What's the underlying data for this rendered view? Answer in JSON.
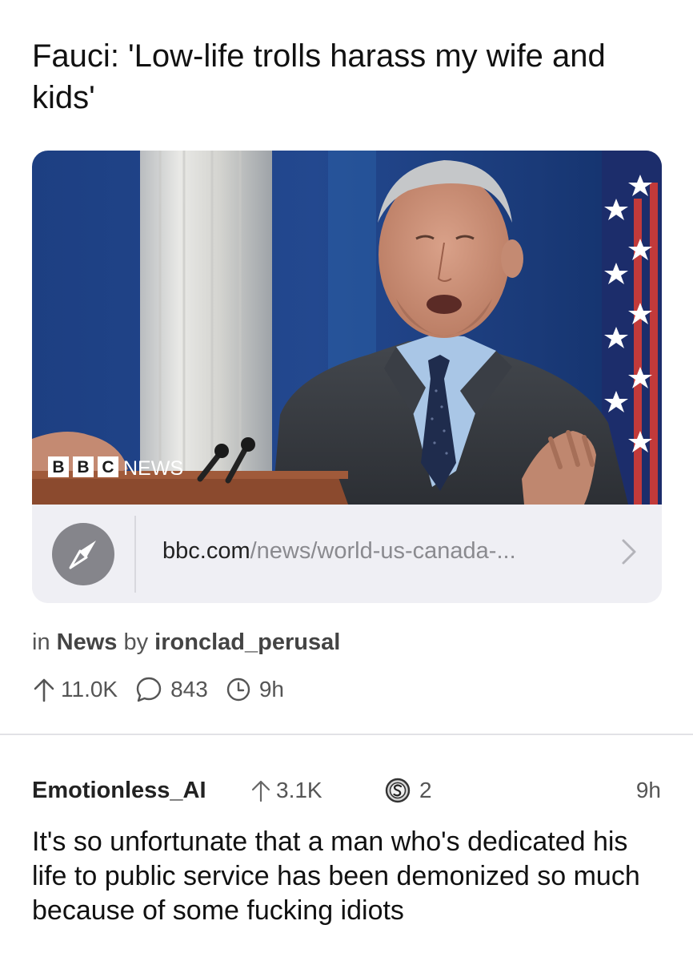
{
  "post": {
    "title": "Fauci: 'Low-life trolls harass my wife and kids'",
    "thumbnail": {
      "watermark_letters": [
        "B",
        "B",
        "C"
      ],
      "watermark_word": "NEWS"
    },
    "link": {
      "domain": "bbc.com",
      "path": "/news/world-us-canada-...",
      "icon": "compass-icon",
      "chevron": "chevron-right-icon"
    },
    "meta": {
      "in_prefix": "in",
      "community": "News",
      "by_prefix": "by",
      "author": "ironclad_perusal"
    },
    "stats": {
      "upvotes": "11.0K",
      "comments": "843",
      "age": "9h"
    }
  },
  "comment": {
    "author": "Emotionless_AI",
    "upvotes": "3.1K",
    "awards": "2",
    "time": "9h",
    "body": "It's so unfortunate that a man who's dedicated his life to public service has been demonized so much because of some fucking idiots"
  },
  "colors": {
    "text": "#111111",
    "secondary_text": "#555555",
    "link_bar_bg": "#efeff4",
    "compass_circle": "#85858b"
  }
}
